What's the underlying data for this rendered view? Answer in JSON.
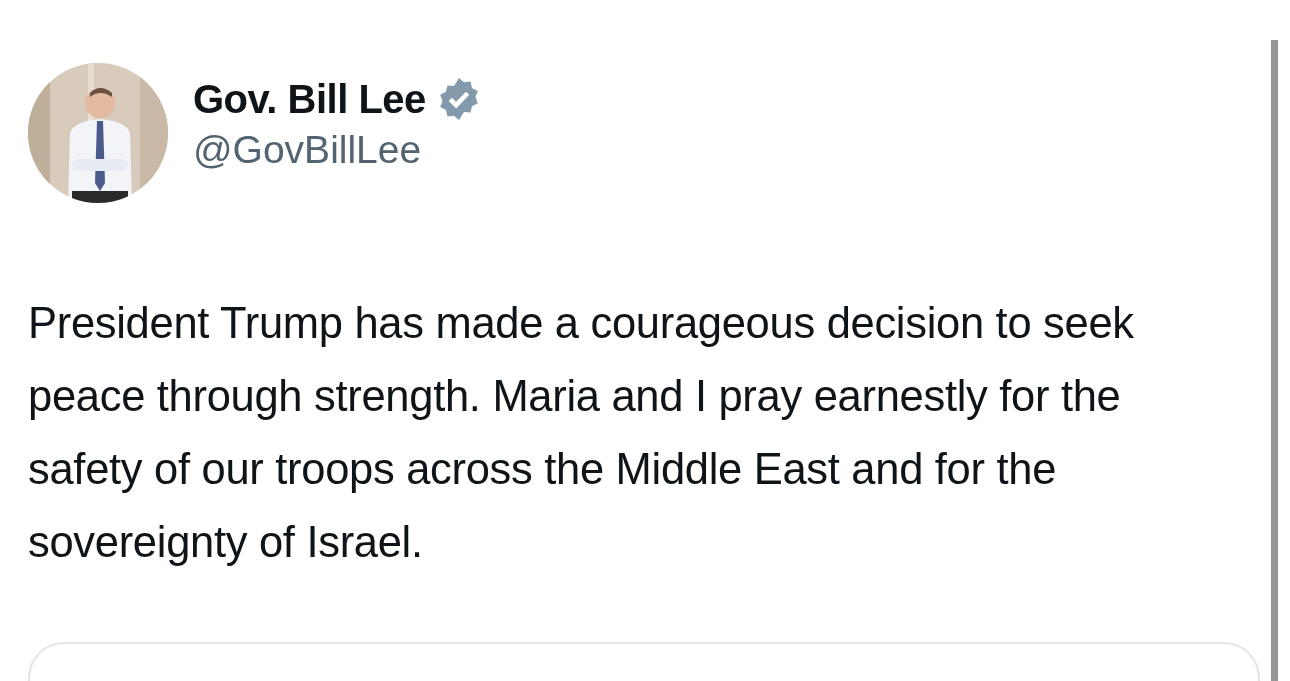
{
  "author": {
    "name": "Gov. Bill Lee",
    "verified": true,
    "handle": "@GovBillLee"
  },
  "post": {
    "text": "President Trump has made a courageous decision to seek peace through strength. Maria and I pray earnestly for the safety of our troops across the Middle East and for the sovereignty of Israel."
  }
}
